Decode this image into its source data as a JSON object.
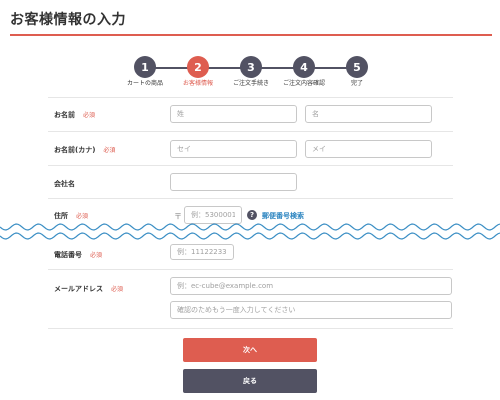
{
  "page": {
    "title": "お客様情報の入力"
  },
  "steps": [
    {
      "number": "1",
      "label": "カートの商品",
      "active": false
    },
    {
      "number": "2",
      "label": "お客様情報",
      "active": true
    },
    {
      "number": "3",
      "label": "ご注文手続き",
      "active": false
    },
    {
      "number": "4",
      "label": "ご注文内容確認",
      "active": false
    },
    {
      "number": "5",
      "label": "完了",
      "active": false
    }
  ],
  "required_label": "必須",
  "form": {
    "name": {
      "label": "お名前",
      "last_placeholder": "姓",
      "first_placeholder": "名"
    },
    "kana": {
      "label": "お名前(カナ)",
      "last_placeholder": "セイ",
      "first_placeholder": "メイ"
    },
    "company": {
      "label": "会社名"
    },
    "address": {
      "label": "住所",
      "zip_mark": "〒",
      "zip_placeholder": "例：5300001",
      "help_glyph": "?",
      "zip_search_link": "郵便番号検索"
    },
    "phone": {
      "label": "電話番号",
      "placeholder": "例：11122233"
    },
    "email": {
      "label": "メールアドレス",
      "placeholder": "例：ec-cube@example.com",
      "confirm_placeholder": "確認のためもう一度入力してください"
    }
  },
  "buttons": {
    "next": "次へ",
    "back": "戻る"
  },
  "colors": {
    "accent": "#de5d50",
    "dark": "#525263",
    "wave": "#3a8ec4",
    "link": "#2e86c1"
  }
}
